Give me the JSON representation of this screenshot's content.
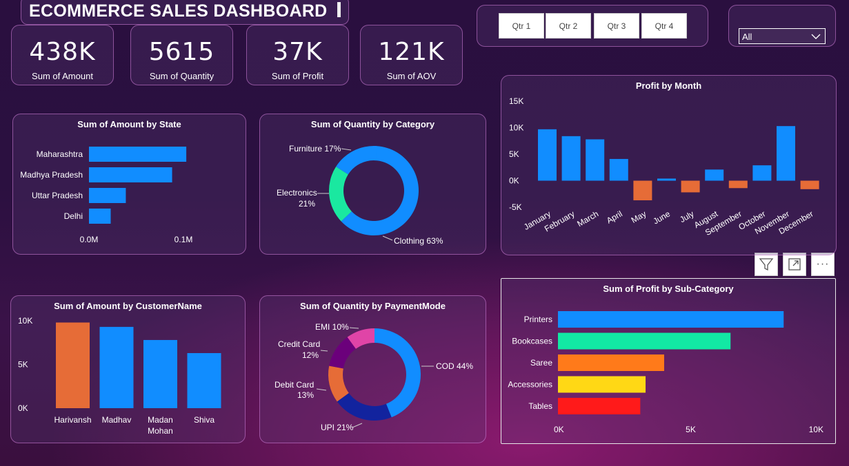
{
  "dashboard": {
    "title": "ECOMMERCE SALES DASHBOARD"
  },
  "kpis": [
    {
      "value": "438K",
      "label": "Sum of Amount"
    },
    {
      "value": "5615",
      "label": "Sum of Quantity"
    },
    {
      "value": "37K",
      "label": "Sum of Profit"
    },
    {
      "value": "121K",
      "label": "Sum of AOV"
    }
  ],
  "quarter_slicer": {
    "buttons": [
      "Qtr 1",
      "Qtr 2",
      "Qtr 3",
      "Qtr 4"
    ]
  },
  "state_slicer": {
    "selected": "All",
    "icon": "chevron-down-icon"
  },
  "toolbar": {
    "icons": [
      "filter-icon",
      "focus-mode-icon",
      "more-options-icon"
    ],
    "more_label": "···"
  },
  "charts": {
    "amount_by_state": {
      "title": "Sum of Amount by State",
      "type": "bar",
      "categories": [
        "Maharashtra",
        "Madhya Pradesh",
        "Uttar Pradesh",
        "Delhi"
      ],
      "values": [
        0.103,
        0.088,
        0.039,
        0.023
      ],
      "xticks": [
        "0.0M",
        "0.1M"
      ],
      "color": "#118DFF"
    },
    "qty_by_category": {
      "title": "Sum of Quantity by Category",
      "type": "pie",
      "slices": [
        {
          "name": "Clothing",
          "pct": 63,
          "label": "Clothing 63%",
          "color": "#118DFF"
        },
        {
          "name": "Electronics",
          "pct": 21,
          "label1": "Electronics",
          "label2": "21%",
          "color": "#1AE8A0"
        },
        {
          "name": "Furniture",
          "pct": 17,
          "label": "Furniture 17%",
          "color": "#118DFF"
        }
      ]
    },
    "profit_by_month": {
      "title": "Profit by Month",
      "type": "bar",
      "categories": [
        "January",
        "February",
        "March",
        "April",
        "May",
        "June",
        "July",
        "August",
        "September",
        "October",
        "November",
        "December"
      ],
      "values": [
        9700,
        8400,
        7800,
        4100,
        -3700,
        400,
        -2200,
        2100,
        -1400,
        2900,
        10300,
        -1600
      ],
      "yticks": [
        "15K",
        "10K",
        "5K",
        "0K",
        "-5K"
      ],
      "ylim": [
        -5000,
        15000
      ],
      "positive_color": "#118DFF",
      "negative_color": "#E66C37"
    },
    "amount_by_customer": {
      "title": "Sum of Amount by CustomerName",
      "type": "bar",
      "categories": [
        "Harivansh",
        "Madhav",
        "Madan Mohan",
        "Shiva"
      ],
      "category_lines": [
        [
          "Harivansh"
        ],
        [
          "Madhav"
        ],
        [
          "Madan",
          "Mohan"
        ],
        [
          "Shiva"
        ]
      ],
      "values": [
        9800,
        9300,
        7800,
        6300
      ],
      "yticks": [
        "10K",
        "5K",
        "0K"
      ],
      "ylim": [
        0,
        10000
      ],
      "colors": [
        "#E66C37",
        "#118DFF",
        "#118DFF",
        "#118DFF"
      ]
    },
    "qty_by_payment": {
      "title": "Sum of Quantity by PaymentMode",
      "type": "pie",
      "slices": [
        {
          "name": "COD",
          "pct": 44,
          "label": "COD 44%",
          "color": "#118DFF"
        },
        {
          "name": "UPI",
          "pct": 21,
          "label": "UPI 21%",
          "color": "#12239E"
        },
        {
          "name": "Debit Card",
          "pct": 13,
          "label1": "Debit Card",
          "label2": "13%",
          "color": "#E66C37"
        },
        {
          "name": "Credit Card",
          "pct": 12,
          "label1": "Credit Card",
          "label2": "12%",
          "color": "#6B007B"
        },
        {
          "name": "EMI",
          "pct": 10,
          "label": "EMI 10%",
          "color": "#E044A7"
        }
      ]
    },
    "profit_by_subcategory": {
      "title": "Sum of Profit by Sub-Category",
      "type": "bar",
      "categories": [
        "Printers",
        "Bookcases",
        "Saree",
        "Accessories",
        "Tables"
      ],
      "values": [
        8500,
        6500,
        4000,
        3300,
        3100
      ],
      "xticks": [
        "0K",
        "5K",
        "10K"
      ],
      "xlim": [
        0,
        10000
      ],
      "colors": [
        "#118DFF",
        "#12E8A4",
        "#FF7A1A",
        "#FFD815",
        "#FF1A1A"
      ]
    }
  }
}
